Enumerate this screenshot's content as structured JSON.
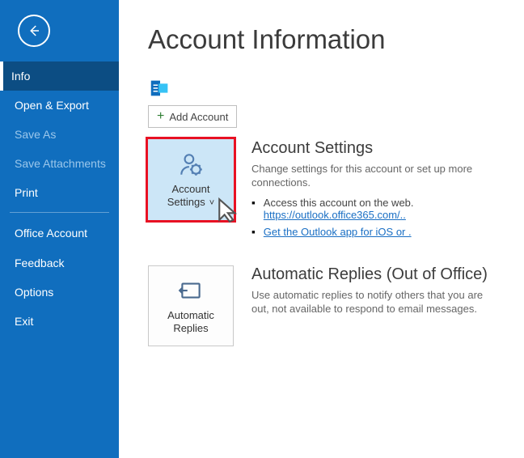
{
  "sidebar": {
    "items": [
      {
        "label": "Info"
      },
      {
        "label": "Open & Export"
      },
      {
        "label": "Save As"
      },
      {
        "label": "Save Attachments"
      },
      {
        "label": "Print"
      },
      {
        "label": "Office Account"
      },
      {
        "label": "Feedback"
      },
      {
        "label": "Options"
      },
      {
        "label": "Exit"
      }
    ]
  },
  "page": {
    "title": "Account Information",
    "add_account_label": "Add Account"
  },
  "account_settings": {
    "tile_label_line1": "Account",
    "tile_label_line2": "Settings",
    "title": "Account Settings",
    "description": "Change settings for this account or set up more connections.",
    "bullet1": "Access this account on the web.",
    "link1": "https://outlook.office365.com/..",
    "link2": "Get the Outlook app for iOS or ."
  },
  "auto_replies": {
    "tile_label_line1": "Automatic",
    "tile_label_line2": "Replies",
    "title": "Automatic Replies (Out of Office)",
    "description": "Use automatic replies to notify others that you are out, not available to respond to email messages."
  }
}
